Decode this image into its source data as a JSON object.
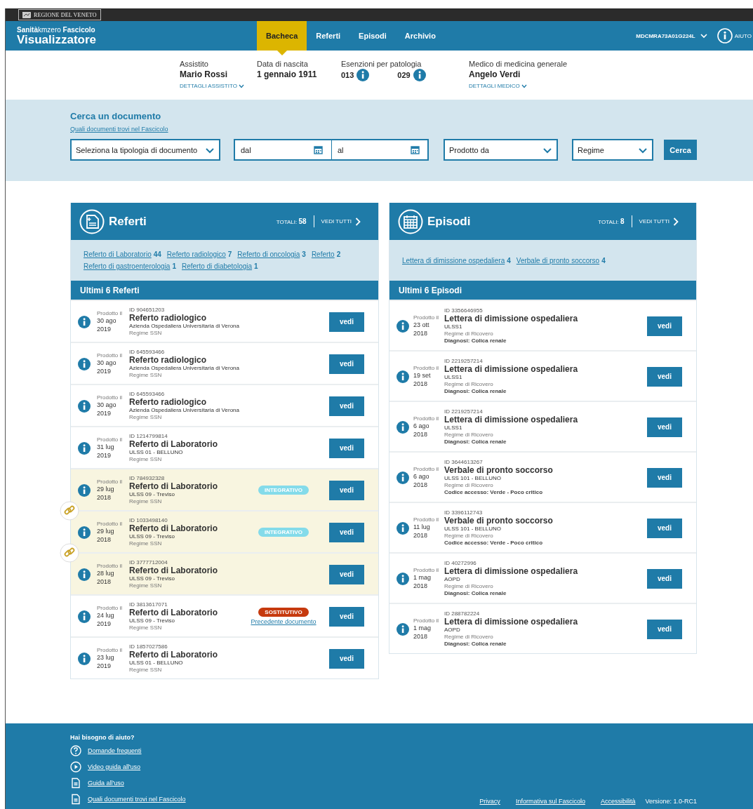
{
  "top_bar": {
    "region_label": "REGIONE DEL VENETO"
  },
  "header": {
    "brand": "**Sanità**kmzero **Fascicolo**",
    "title": "Visualizzatore",
    "nav": [
      {
        "label": "Bacheca",
        "selected": true
      },
      {
        "label": "Referti",
        "selected": false
      },
      {
        "label": "Episodi",
        "selected": false
      },
      {
        "label": "Archivio",
        "selected": false
      }
    ],
    "user_code": "MDCMRA73A01G224L",
    "help_label": "AIUTO"
  },
  "patient": {
    "fields": [
      {
        "label": "Assistito",
        "value": "Mario Rossi",
        "link": "DETTAGLI ASSISTITO"
      },
      {
        "label": "Data di nascita",
        "value": "1 gennaio 1911"
      },
      {
        "label": "Esenzioni per patologia",
        "codes": [
          "013",
          "029"
        ]
      },
      {
        "label": "Medico di medicina generale",
        "value": "Angelo Verdi",
        "link": "DETTAGLI MEDICO"
      }
    ]
  },
  "search": {
    "title": "Cerca un documento",
    "link": "Quali documenti trovi nel Fascicolo",
    "fields": [
      {
        "kind": "select",
        "placeholder": "Seleziona la tipologia di documento"
      },
      {
        "kind": "date",
        "placeholder": "dal"
      },
      {
        "kind": "date",
        "placeholder": "al"
      },
      {
        "kind": "select",
        "placeholder": "Prodotto da"
      },
      {
        "kind": "select",
        "placeholder": "Regime"
      }
    ],
    "button": "Cerca"
  },
  "panels": [
    {
      "kind": "referti",
      "title": "Referti",
      "totals_label": "TOTALI:",
      "totals_value": "58",
      "see_all": "VEDI TUTTI",
      "categories": [
        {
          "label": "Referto di Laboratorio",
          "count": "44"
        },
        {
          "label": "Referto radiologico",
          "count": "7"
        },
        {
          "label": "Referto di oncologia",
          "count": "3"
        },
        {
          "label": "Referto",
          "count": "2"
        },
        {
          "label": "Referto di gastroenterologia",
          "count": "1"
        },
        {
          "label": "Referto di diabetologia",
          "count": "1"
        }
      ],
      "list_title": "Ultimi 6 Referti",
      "items": [
        {
          "produced_label": "Prodotto il",
          "day": "30 ago",
          "year": "2019",
          "id": "ID 904651203",
          "title": "Referto radiologico",
          "org": "Azienda Ospedaliera Universitaria di Verona",
          "regime": "Regime SSN",
          "highlighted": false,
          "linked_to_next": false,
          "button": "vedi"
        },
        {
          "produced_label": "Prodotto il",
          "day": "30 ago",
          "year": "2019",
          "id": "ID 645593466",
          "title": "Referto radiologico",
          "org": "Azienda Ospedaliera Universitaria di Verona",
          "regime": "Regime SSN",
          "highlighted": false,
          "linked_to_next": false,
          "button": "vedi"
        },
        {
          "produced_label": "Prodotto il",
          "day": "30 ago",
          "year": "2019",
          "id": "ID 645593466",
          "title": "Referto radiologico",
          "org": "Azienda Ospedaliera Universitaria di Verona",
          "regime": "Regime SSN",
          "highlighted": false,
          "linked_to_next": false,
          "button": "vedi"
        },
        {
          "produced_label": "Prodotto il",
          "day": "31 lug",
          "year": "2019",
          "id": "ID 1214799814",
          "title": "Referto di Laboratorio",
          "org": "ULSS 01 - BELLUNO",
          "regime": "Regime SSN",
          "highlighted": false,
          "linked_to_next": false,
          "button": "vedi"
        },
        {
          "produced_label": "Prodotto il",
          "day": "29 lug",
          "year": "2018",
          "id": "ID 784932328",
          "title": "Referto di Laboratorio",
          "org": "ULSS 09 - Treviso",
          "regime": "Regime SSN",
          "highlighted": true,
          "linked_to_next": true,
          "badge": {
            "kind": "integrativo",
            "label": "INTEGRATIVO"
          },
          "button": "vedi"
        },
        {
          "produced_label": "Prodotto il",
          "day": "29 lug",
          "year": "2018",
          "id": "ID 1033498140",
          "title": "Referto di Laboratorio",
          "org": "ULSS 09 - Treviso",
          "regime": "Regime SSN",
          "highlighted": true,
          "linked_to_next": true,
          "badge": {
            "kind": "integrativo",
            "label": "INTEGRATIVO"
          },
          "button": "vedi"
        },
        {
          "produced_label": "Prodotto il",
          "day": "28 lug",
          "year": "2018",
          "id": "ID 3777712004",
          "title": "Referto di Laboratorio",
          "org": "ULSS 09 - Treviso",
          "regime": "Regime SSN",
          "highlighted": true,
          "linked_to_next": false,
          "button": "vedi"
        },
        {
          "produced_label": "Prodotto il",
          "day": "24 lug",
          "year": "2019",
          "id": "ID 3813617071",
          "title": "Referto di Laboratorio",
          "org": "ULSS 09 - Treviso",
          "regime": "Regime SSN",
          "highlighted": false,
          "linked_to_next": false,
          "badge": {
            "kind": "sostitutivo",
            "label": "SOSTITUTIVO"
          },
          "badge_link": "Precedente documento",
          "button": "vedi"
        },
        {
          "produced_label": "Prodotto il",
          "day": "23 lug",
          "year": "2019",
          "id": "ID 1857027586",
          "title": "Referto di Laboratorio",
          "org": "ULSS 01 - BELLUNO",
          "regime": "Regime SSN",
          "highlighted": false,
          "linked_to_next": false,
          "button": "vedi"
        }
      ]
    },
    {
      "kind": "episodi",
      "title": "Episodi",
      "totals_label": "TOTALI:",
      "totals_value": "8",
      "see_all": "VEDI TUTTI",
      "categories": [
        {
          "label": "Lettera di dimissione ospedaliera",
          "count": "4"
        },
        {
          "label": "Verbale di pronto soccorso",
          "count": "4"
        }
      ],
      "list_title": "Ultimi 6 Episodi",
      "items": [
        {
          "produced_label": "Prodotto il",
          "day": "23 ott",
          "year": "2018",
          "id": "ID 3356646955",
          "title": "Lettera di dimissione ospedaliera",
          "org": "ULSS1",
          "regime": "Regime di Ricovero",
          "detail": "Diagnosi: Colica renale",
          "highlighted": false,
          "linked_to_next": false,
          "button": "vedi"
        },
        {
          "produced_label": "Prodotto il",
          "day": "19 set",
          "year": "2018",
          "id": "ID 2219257214",
          "title": "Lettera di dimissione ospedaliera",
          "org": "ULSS1",
          "regime": "Regime di Ricovero",
          "detail": "Diagnosi: Colica renale",
          "highlighted": false,
          "linked_to_next": false,
          "button": "vedi"
        },
        {
          "produced_label": "Prodotto il",
          "day": "6 ago",
          "year": "2018",
          "id": "ID 2219257214",
          "title": "Lettera di dimissione ospedaliera",
          "org": "ULSS1",
          "regime": "Regime di Ricovero",
          "detail": "Diagnosi: Colica renale",
          "highlighted": false,
          "linked_to_next": false,
          "button": "vedi"
        },
        {
          "produced_label": "Prodotto il",
          "day": "6 ago",
          "year": "2018",
          "id": "ID 3644613267",
          "title": "Verbale di pronto soccorso",
          "org": "ULSS 101 - BELLUNO",
          "regime": "Regime di Ricovero",
          "detail": "Codice accesso: Verde - Poco critico",
          "highlighted": false,
          "linked_to_next": false,
          "button": "vedi"
        },
        {
          "produced_label": "Prodotto il",
          "day": "11 lug",
          "year": "2018",
          "id": "ID 3396112743",
          "title": "Verbale di pronto soccorso",
          "org": "ULSS 101 - BELLUNO",
          "regime": "Regime di Ricovero",
          "detail": "Codice accesso: Verde - Poco critico",
          "highlighted": false,
          "linked_to_next": false,
          "button": "vedi"
        },
        {
          "produced_label": "Prodotto il",
          "day": "1 mag",
          "year": "2018",
          "id": "ID 40272996",
          "title": "Lettera di dimissione ospedaliera",
          "org": "AOPD",
          "regime": "Regime di Ricovero",
          "detail": "Diagnosi: Colica renale",
          "highlighted": false,
          "linked_to_next": false,
          "button": "vedi"
        },
        {
          "produced_label": "Prodotto il",
          "day": "1 mag",
          "year": "2018",
          "id": "ID 288782224",
          "title": "Lettera di dimissione ospedaliera",
          "org": "AOPD",
          "regime": "Regime di Ricovero",
          "detail": "Diagnosi: Colica renale",
          "highlighted": false,
          "linked_to_next": false,
          "button": "vedi"
        }
      ]
    }
  ],
  "footer": {
    "help_title": "Hai bisogno di aiuto?",
    "help_links": [
      {
        "kind": "question",
        "label": "Domande frequenti"
      },
      {
        "kind": "video",
        "label": "Video guida all'uso"
      },
      {
        "kind": "document",
        "label": "Guida all'uso"
      },
      {
        "kind": "document",
        "label": "Quali documenti trovi nel Fascicolo"
      }
    ],
    "bottom_links": [
      "Privacy",
      "Informativa sul Fascicolo",
      "Accessibilità"
    ],
    "version": "Versione: 1.0-RC1"
  }
}
